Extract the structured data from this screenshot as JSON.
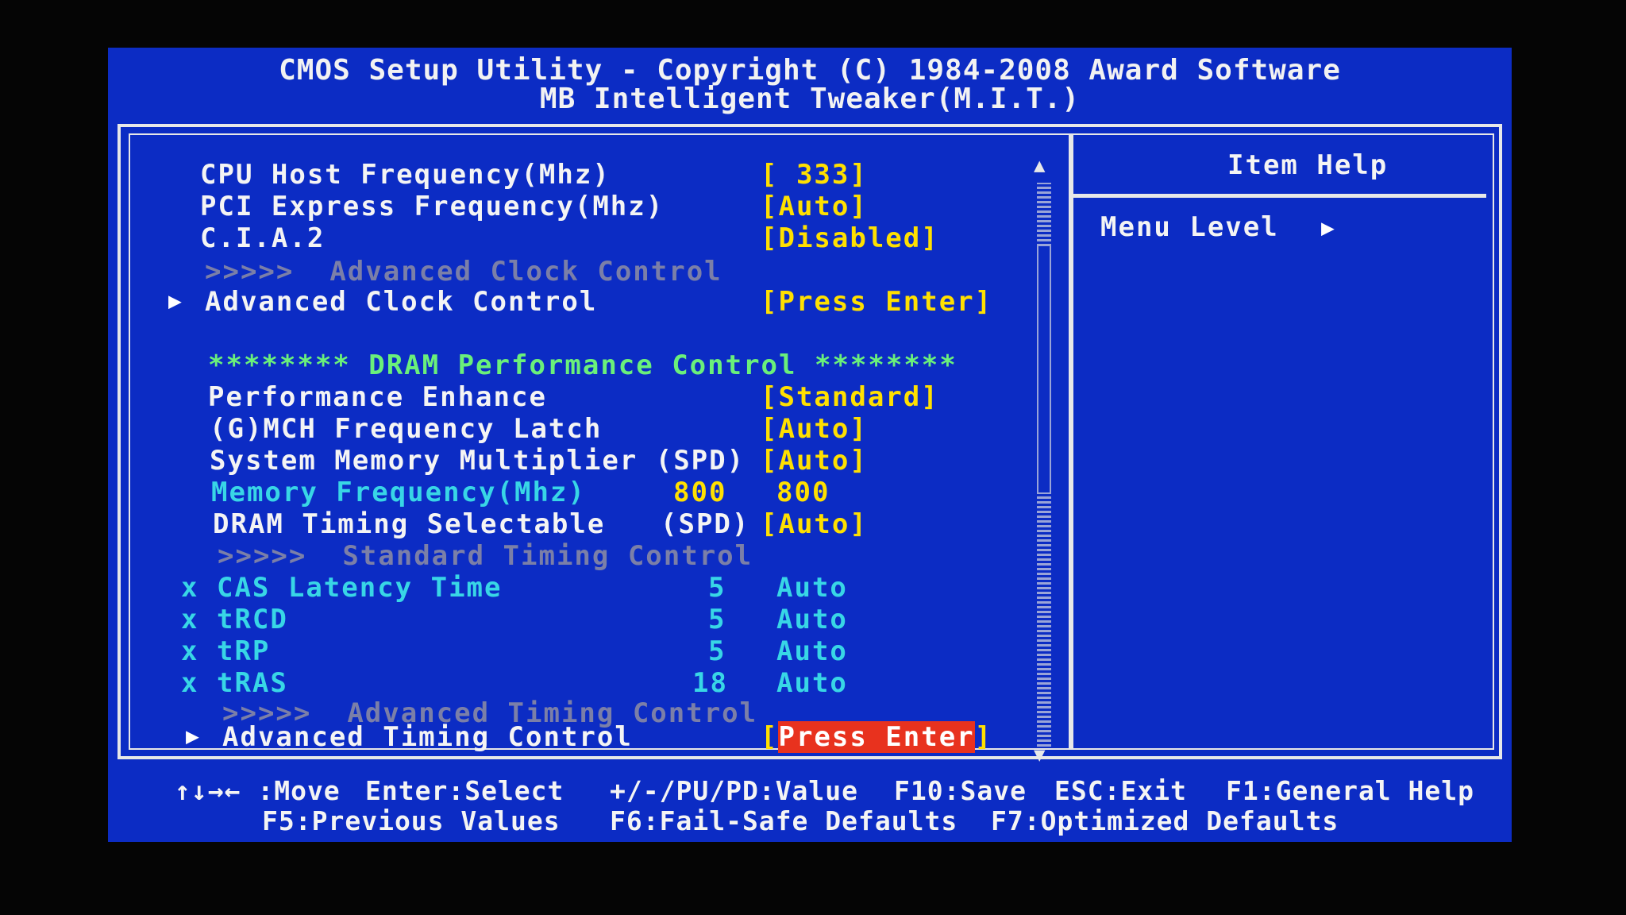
{
  "header": {
    "line1": "CMOS Setup Utility - Copyright (C) 1984-2008 Award Software",
    "line2": "MB Intelligent Tweaker(M.I.T.)"
  },
  "settings": {
    "cpu_host_freq": {
      "label": "CPU Host Frequency(Mhz)",
      "value": "[ 333]"
    },
    "pci_express_freq": {
      "label": "PCI Express Frequency(Mhz)",
      "value": "[Auto]"
    },
    "cia2": {
      "label": "C.I.A.2",
      "value": "[Disabled]"
    },
    "adv_clock_header": {
      "prefix": ">>>>>",
      "label": "Advanced Clock Control"
    },
    "adv_clock": {
      "label": "Advanced Clock Control",
      "value": "[Press Enter]"
    },
    "dram_section": "******** DRAM Performance Control ********",
    "perf_enhance": {
      "label": "Performance Enhance",
      "value": "[Standard]"
    },
    "gmch_latch": {
      "label": "(G)MCH Frequency Latch",
      "value": "[Auto]"
    },
    "sys_mem_mult": {
      "label": "System Memory Multiplier (SPD)",
      "value": "[Auto]"
    },
    "mem_freq": {
      "label": "Memory Frequency(Mhz)",
      "current": "800",
      "value": "800"
    },
    "dram_timing_sel": {
      "label": "DRAM Timing Selectable",
      "spd": "(SPD)",
      "value": "[Auto]"
    },
    "std_timing_header": {
      "prefix": ">>>>>",
      "label": "Standard Timing Control"
    },
    "timings": [
      {
        "mark": "x",
        "label": "CAS Latency Time",
        "current": "5",
        "value": "Auto"
      },
      {
        "mark": "x",
        "label": "tRCD",
        "current": "5",
        "value": "Auto"
      },
      {
        "mark": "x",
        "label": "tRP",
        "current": "5",
        "value": "Auto"
      },
      {
        "mark": "x",
        "label": "tRAS",
        "current": "18",
        "value": "Auto"
      }
    ],
    "adv_timing_header": {
      "prefix": ">>>>>",
      "label": "Advanced Timing Control"
    },
    "adv_timing": {
      "label": "Advanced Timing Control",
      "open": "[",
      "value": "Press Enter",
      "close": "]"
    }
  },
  "help": {
    "title": "Item Help",
    "menu_level": "Menu Level"
  },
  "footer": {
    "line1": [
      "↑↓→← :Move",
      "Enter:Select",
      "+/-/PU/PD:Value",
      "F10:Save",
      "ESC:Exit",
      "F1:General Help"
    ],
    "line2": [
      "F5:Previous Values",
      "F6:Fail-Safe Defaults",
      "F7:Optimized Defaults"
    ]
  }
}
